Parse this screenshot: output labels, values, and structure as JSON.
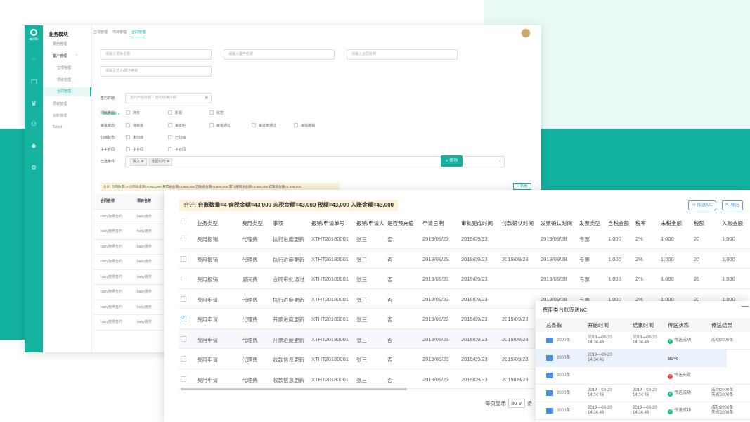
{
  "brand": {
    "name": "apollo"
  },
  "menu": {
    "title": "业务模块",
    "items": [
      "费用管理",
      "客户管理",
      "立项管理",
      "项目管理",
      "合同管理",
      "项目管理",
      "台账管理",
      "Talent"
    ]
  },
  "tabs": [
    "立项管理",
    "项目管理",
    "合同管理"
  ],
  "filters": {
    "placeholders": [
      "请输入项目名称",
      "请输入客户名称",
      "请输入合同名称",
      "请输入艺人/博主名称"
    ],
    "advanced": "高级搜索 ∧",
    "date_label": "签约日期:",
    "date_placeholder": "签约开始日期 ~ 签约结束日期",
    "type_label": "项目类型:",
    "type_options": [
      "商务",
      "影视",
      "综艺"
    ],
    "audit_label": "审批状态:",
    "audit_options": [
      "待审批",
      "审批中",
      "审批通过",
      "审批未通过",
      "审批撤销"
    ],
    "archive_label": "归档状态:",
    "archive_options": [
      "未归档",
      "已归档"
    ],
    "sub_label": "主子合同:",
    "sub_options": [
      "主合同",
      "子合同"
    ],
    "selected_label": "已选条件:",
    "chips": [
      "致文",
      "集团公司"
    ],
    "search_button": "查询"
  },
  "summary1": "合计: 合同数量=2  合同总金额=5,000,000  开票总金额=2,600,000  回款总金额=2,600,000  累计报销总金额=2,600,000  结算总金额=2,600,000",
  "add_button": "+ 新增",
  "table1": {
    "headers": [
      "合同名称",
      "项目名称"
    ],
    "rows": [
      [
        "baby施男签约",
        "baby施男"
      ],
      [
        "baby施男签约",
        "baby施男"
      ],
      [
        "baby施男签约",
        "baby施男"
      ],
      [
        "baby施男签约",
        "baby施男"
      ],
      [
        "baby施男签约",
        "baby施男"
      ],
      [
        "baby施男签约",
        "baby施男"
      ],
      [
        "baby施男签约",
        "baby施男"
      ],
      [
        "baby施男签约",
        "baby施男"
      ]
    ]
  },
  "summary2": {
    "prefix": "合计:",
    "items": [
      "台账数量=4",
      "含税金额=43,000",
      "未税金额=43,000",
      "税额=43,000",
      "入账金额=43,000"
    ]
  },
  "buttons": {
    "transfer": "传送NC",
    "export": "导出"
  },
  "table2": {
    "headers": [
      "业务类型",
      "费用类型",
      "事项",
      "报销/申请单号",
      "报销/申请人",
      "是否预充值",
      "申请日期",
      "审批完成时间",
      "付款确认时间",
      "发票确认时间",
      "发票类型",
      "含税金额",
      "税率",
      "未税金额",
      "税额",
      "入账金额"
    ],
    "rows": [
      {
        "checked": false,
        "cells": [
          "费用报销",
          "代理费",
          "执行进度更新",
          "XTHT20180001",
          "张三",
          "否",
          "2019/09/23",
          "2019/09/23",
          "",
          "2019/09/28",
          "专票",
          "1,000",
          "2%",
          "1,000",
          "20",
          "1,000"
        ]
      },
      {
        "checked": false,
        "cells": [
          "费用报销",
          "代理费",
          "执行进度更新",
          "XTHT20180001",
          "张三",
          "否",
          "2019/09/23",
          "2019/09/23",
          "2019/09/28",
          "2019/09/28",
          "专票",
          "1,000",
          "2%",
          "1,000",
          "20",
          "1,000"
        ]
      },
      {
        "checked": false,
        "cells": [
          "费用报销",
          "居间费",
          "合同审批通过",
          "XTHT20180001",
          "张三",
          "否",
          "2019/09/23",
          "2019/09/23",
          "",
          "2019/09/28",
          "专票",
          "1,000",
          "2%",
          "1,000",
          "20",
          "1,000"
        ]
      },
      {
        "checked": false,
        "cells": [
          "费用申请",
          "代理费",
          "执行进度更新",
          "XTHT20180001",
          "张三",
          "否",
          "2019/09/23",
          "2019/09/23",
          "",
          "2019/09/28",
          "专票",
          "1,000",
          "2%",
          "1,000",
          "20",
          "1,000"
        ]
      },
      {
        "checked": true,
        "cells": [
          "费用申请",
          "代理费",
          "开票进度更新",
          "XTHT20180001",
          "张三",
          "否",
          "2019/09/23",
          "2019/09/23",
          "2019/09/28",
          "",
          "",
          "",
          "",
          "",
          "",
          ""
        ]
      },
      {
        "checked": false,
        "cells": [
          "费用申请",
          "代理费",
          "开票进度更新",
          "XTHT20180001",
          "张三",
          "否",
          "2019/09/23",
          "2019/09/23",
          "2019/09/28",
          "",
          "",
          "",
          "",
          "",
          "",
          ""
        ]
      },
      {
        "checked": false,
        "cells": [
          "费用申请",
          "代理费",
          "收款信息更新",
          "XTHT20180001",
          "张三",
          "否",
          "2019/09/23",
          "2019/09/23",
          "2019/09/28",
          "",
          "",
          "",
          "",
          "",
          "",
          ""
        ]
      },
      {
        "checked": false,
        "cells": [
          "费用申请",
          "代理费",
          "收款信息更新",
          "XTHT20180001",
          "张三",
          "否",
          "2019/09/23",
          "2019/09/23",
          "2019/09/28",
          "",
          "",
          "",
          "",
          "",
          "",
          ""
        ]
      }
    ]
  },
  "pager": {
    "prefix": "每页显示",
    "value": "30 ∨",
    "suffix": "条"
  },
  "panel": {
    "title": "费用类台账传送NC",
    "minimize": "—",
    "headers": [
      "总条数",
      "开始时间",
      "结束时间",
      "传送状态",
      "传送结果"
    ],
    "rows": [
      {
        "count": "2000条",
        "start": "2019—08-20\n14:34:46",
        "end": "2019—08-20\n14:34:46",
        "status": "传送成功",
        "status_type": "ok",
        "result": "成功2000条"
      },
      {
        "count": "2000条",
        "start": "2019—08-20\n14:34:46",
        "end": "",
        "status": "85%",
        "status_type": "progress",
        "result": ""
      },
      {
        "count": "2000条",
        "start": "",
        "end": "",
        "status": "传送失败",
        "status_type": "err",
        "result": ""
      },
      {
        "count": "2000条",
        "start": "2019—08-20\n14:34:46",
        "end": "2019—08-20\n14:34:46",
        "status": "传送成功",
        "status_type": "ok",
        "result": "成功2000条\n失败2000条"
      },
      {
        "count": "2000条",
        "start": "2019—08-20\n14:34:46",
        "end": "2019—08-20\n14:34:46",
        "status": "传送成功",
        "status_type": "ok",
        "result": "成功2000条\n失败2000条"
      }
    ]
  },
  "colors": {
    "accent": "#13b3a0",
    "blue": "#4a90e2",
    "summary_bg": "#fdf3d8"
  }
}
